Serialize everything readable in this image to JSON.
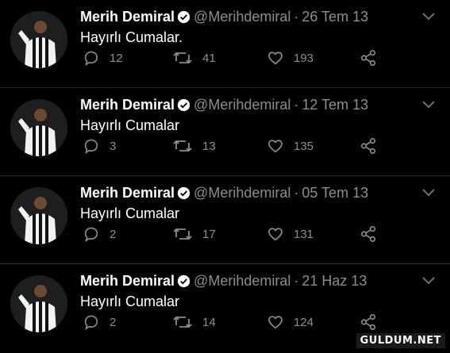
{
  "tweets": [
    {
      "name": "Merih Demiral",
      "handle": "@Merihdemiral",
      "date": "26 Tem 13",
      "text": "Hayırlı Cumalar.",
      "replies": "12",
      "retweets": "41",
      "likes": "193"
    },
    {
      "name": "Merih Demiral",
      "handle": "@Merihdemiral",
      "date": "12 Tem 13",
      "text": "Hayırlı Cumalar",
      "replies": "3",
      "retweets": "13",
      "likes": "135"
    },
    {
      "name": "Merih Demiral",
      "handle": "@Merihdemiral",
      "date": "05 Tem 13",
      "text": "Hayırlı Cumalar",
      "replies": "2",
      "retweets": "17",
      "likes": "131"
    },
    {
      "name": "Merih Demiral",
      "handle": "@Merihdemiral",
      "date": "21 Haz 13",
      "text": "Hayırlı Cumalar",
      "replies": "2",
      "retweets": "14",
      "likes": "124"
    }
  ],
  "separator": "·",
  "watermark": "GULDUM.NET",
  "colors": {
    "background": "#000000",
    "muted": "#8a8d91",
    "text": "#ffffff"
  },
  "icons": {
    "reply": "reply-icon",
    "retweet": "retweet-icon",
    "like": "heart-icon",
    "share": "share-icon",
    "verified": "verified-badge-icon",
    "menu": "chevron-down-icon"
  }
}
